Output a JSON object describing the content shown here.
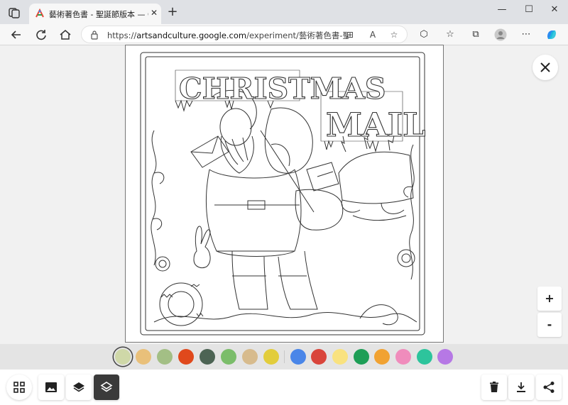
{
  "browser": {
    "tab": {
      "title": "藝術著色書 - 聖誕節版本 — Goo",
      "close_glyph": "✕"
    },
    "new_tab_glyph": "+",
    "window_controls": {
      "minimize": "—",
      "maximize": "☐",
      "close": "✕"
    },
    "address_bar": {
      "url_prefix": "https://",
      "url_host": "artsandculture.google.com",
      "url_path": "/experiment/藝術著色書-聖誕..."
    },
    "toolbar_icons": [
      "tabs-icon",
      "read-aloud-icon",
      "favorite-star-icon",
      "extensions-icon",
      "favorites-icon",
      "collections-icon",
      "profile-avatar",
      "more-menu-icon",
      "copilot-icon"
    ]
  },
  "artwork": {
    "title_line1": "CHRISTMAS",
    "title_line2": "MAIL"
  },
  "controls": {
    "close_glyph": "✕",
    "zoom_in": "+",
    "zoom_out": "-"
  },
  "palette": {
    "selected_index": 0,
    "group1": [
      "#cfd8a8",
      "#e9c07a",
      "#a3bf85",
      "#e0491c",
      "#4d6454",
      "#7bbd6a",
      "#d7bb8d",
      "#e2cd3c"
    ],
    "group2": [
      "#4a86e8",
      "#d9453b",
      "#f9e27f",
      "#1e9e56",
      "#f1a232",
      "#f08cbc",
      "#2dc49c",
      "#b678e5"
    ]
  },
  "bottom_toolbar": {
    "left": [
      "grid-menu-icon",
      "image-icon",
      "layers-icon",
      "layers-outline-icon"
    ],
    "right": [
      "trash-icon",
      "download-icon",
      "share-icon"
    ],
    "active": "layers-outline-icon"
  }
}
